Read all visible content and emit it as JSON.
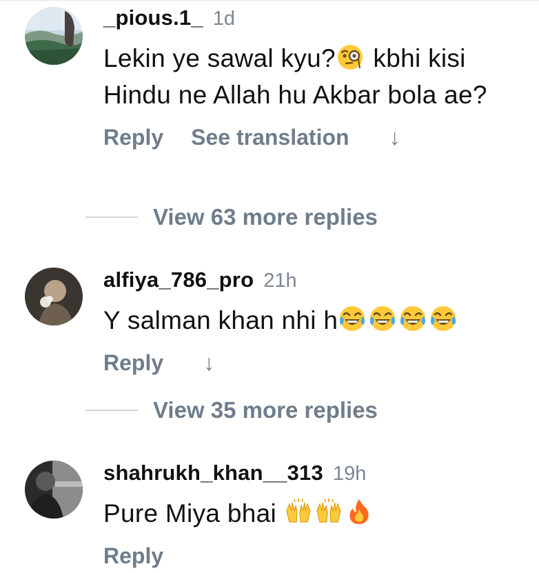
{
  "comments": [
    {
      "username": "_pious.1_",
      "time": "1d",
      "text": [
        "Lekin ye sawal kyu?",
        " kbhi kisi Hindu ne Allah hu Akbar bola ae?"
      ],
      "emojis": [
        "face-with-monocle-icon"
      ],
      "reply_label": "Reply",
      "translate_label": "See translation",
      "arrow": "↓",
      "view_more": "View 63 more replies"
    },
    {
      "username": "alfiya_786_pro",
      "time": "21h",
      "text": [
        "Y salman khan nhi h"
      ],
      "emojis": [
        "tears-of-joy-icon",
        "tears-of-joy-icon",
        "tears-of-joy-icon",
        "tears-of-joy-icon"
      ],
      "reply_label": "Reply",
      "arrow": "↓",
      "view_more": "View 35 more replies"
    },
    {
      "username": "shahrukh_khan__313",
      "time": "19h",
      "text": [
        "Pure Miya bhai "
      ],
      "emojis": [
        "raising-hands-icon",
        "raising-hands-icon",
        "fire-icon"
      ],
      "reply_label": "Reply"
    }
  ],
  "colors": {
    "meta_gray": "#7b8794",
    "action_gray": "#6f7d8a",
    "emoji_yellow": "#ffc93c",
    "fire_orange": "#ff6a1a"
  }
}
